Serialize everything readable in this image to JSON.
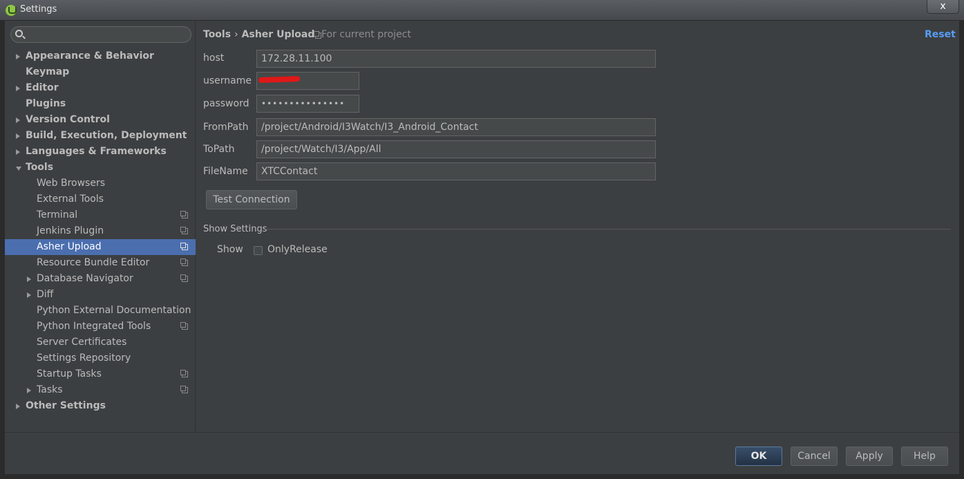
{
  "window": {
    "title": "Settings",
    "close_glyph": "x"
  },
  "search": {
    "placeholder": "",
    "value": ""
  },
  "sidebar": {
    "items": [
      {
        "label": "Appearance & Behavior",
        "level": 0,
        "bold": true,
        "arrow": "right"
      },
      {
        "label": "Keymap",
        "level": 0,
        "bold": true,
        "arrow": "none"
      },
      {
        "label": "Editor",
        "level": 0,
        "bold": true,
        "arrow": "right"
      },
      {
        "label": "Plugins",
        "level": 0,
        "bold": true,
        "arrow": "none"
      },
      {
        "label": "Version Control",
        "level": 0,
        "bold": true,
        "arrow": "right"
      },
      {
        "label": "Build, Execution, Deployment",
        "level": 0,
        "bold": true,
        "arrow": "right"
      },
      {
        "label": "Languages & Frameworks",
        "level": 0,
        "bold": true,
        "arrow": "right"
      },
      {
        "label": "Tools",
        "level": 0,
        "bold": true,
        "arrow": "down"
      },
      {
        "label": "Web Browsers",
        "level": 1,
        "arrow": "none"
      },
      {
        "label": "External Tools",
        "level": 1,
        "arrow": "none"
      },
      {
        "label": "Terminal",
        "level": 1,
        "arrow": "none",
        "project": true
      },
      {
        "label": "Jenkins Plugin",
        "level": 1,
        "arrow": "none",
        "project": true
      },
      {
        "label": "Asher Upload",
        "level": 1,
        "arrow": "none",
        "project": true,
        "selected": true
      },
      {
        "label": "Resource Bundle Editor",
        "level": 1,
        "arrow": "none",
        "project": true
      },
      {
        "label": "Database Navigator",
        "level": 1,
        "arrow": "right",
        "project": true
      },
      {
        "label": "Diff",
        "level": 1,
        "arrow": "right"
      },
      {
        "label": "Python External Documentation",
        "level": 1,
        "arrow": "none"
      },
      {
        "label": "Python Integrated Tools",
        "level": 1,
        "arrow": "none",
        "project": true
      },
      {
        "label": "Server Certificates",
        "level": 1,
        "arrow": "none"
      },
      {
        "label": "Settings Repository",
        "level": 1,
        "arrow": "none"
      },
      {
        "label": "Startup Tasks",
        "level": 1,
        "arrow": "none",
        "project": true
      },
      {
        "label": "Tasks",
        "level": 1,
        "arrow": "right",
        "project": true
      },
      {
        "label": "Other Settings",
        "level": 0,
        "bold": true,
        "arrow": "right"
      }
    ]
  },
  "header": {
    "crumb_parent": "Tools",
    "crumb_sep": "›",
    "crumb_current": "Asher Upload",
    "scope": "For current project",
    "reset": "Reset"
  },
  "form": {
    "host_label": "host",
    "host_value": "172.28.11.100",
    "username_label": "username",
    "username_value": "",
    "password_label": "password",
    "password_value": "•••••••••••••••",
    "frompath_label": "FromPath",
    "frompath_value": "/project/Android/I3Watch/I3_Android_Contact",
    "topath_label": "ToPath",
    "topath_value": "/project/Watch/I3/App/All",
    "filename_label": "FileName",
    "filename_value": "XTCContact",
    "test_button": "Test Connection"
  },
  "show_settings": {
    "title": "Show Settings",
    "show_label": "Show",
    "only_release_label": "OnlyRelease",
    "only_release_checked": false
  },
  "buttons": {
    "ok": "OK",
    "cancel": "Cancel",
    "apply": "Apply",
    "help": "Help"
  },
  "colors": {
    "selection": "#4b6eaf",
    "link": "#589df6",
    "panel": "#3c3f41",
    "redaction": "#e01818"
  },
  "icons": {
    "app": "android-studio-icon",
    "search": "search-icon",
    "project": "project-scope-icon"
  }
}
